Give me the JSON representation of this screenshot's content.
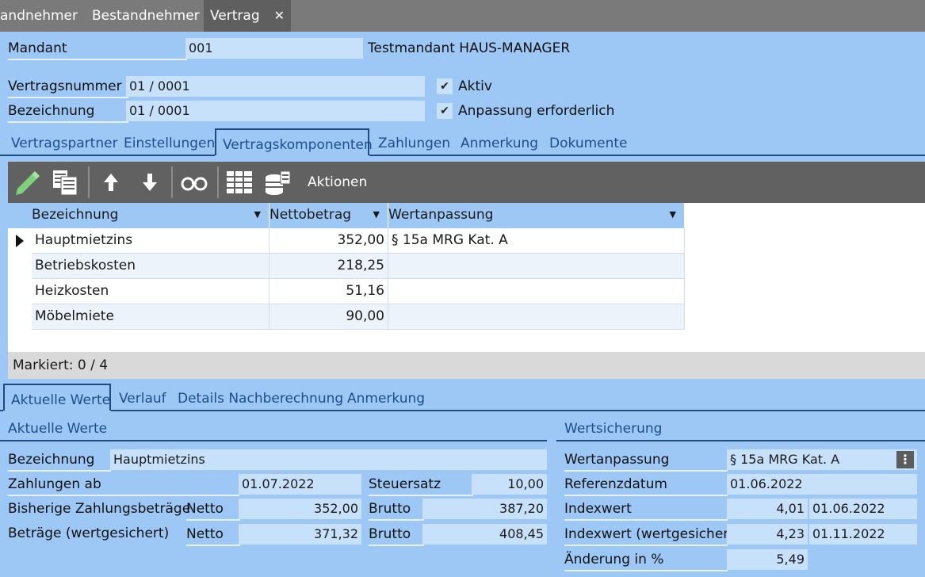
{
  "top_tabs": [
    {
      "label": "andnehmer"
    },
    {
      "label": "Bestandnehmer"
    },
    {
      "label": "Vertrag",
      "close": "✕"
    }
  ],
  "mandant": {
    "label": "Mandant",
    "code": "001",
    "name": "Testmandant HAUS-MANAGER"
  },
  "contract": {
    "number_label": "Vertragsnummer",
    "number": "01 / 0001",
    "desc_label": "Bezeichnung",
    "desc": "01 / 0001",
    "active_label": "Aktiv",
    "active_checked": true,
    "adjust_label": "Anpassung erforderlich",
    "adjust_checked": true
  },
  "main_tabs": [
    "Vertragspartner",
    "Einstellungen",
    "Vertragskomponenten",
    "Zahlungen",
    "Anmerkung",
    "Dokumente"
  ],
  "main_tabs_active": 2,
  "toolbar": {
    "actions_label": "Aktionen"
  },
  "grid": {
    "columns": [
      "Bezeichnung",
      "Nettobetrag",
      "Wertanpassung"
    ],
    "rows": [
      {
        "bezeichnung": "Hauptmietzins",
        "netto": "352,00",
        "wertanpassung": "§ 15a MRG Kat. A"
      },
      {
        "bezeichnung": "Betriebskosten",
        "netto": "218,25",
        "wertanpassung": ""
      },
      {
        "bezeichnung": "Heizkosten",
        "netto": "51,16",
        "wertanpassung": ""
      },
      {
        "bezeichnung": "Möbelmiete",
        "netto": "90,00",
        "wertanpassung": ""
      }
    ],
    "marked": "Markiert: 0 / 4"
  },
  "sub_tabs": [
    "Aktuelle Werte",
    "Verlauf",
    "Details Nachberechnung",
    "Anmerkung"
  ],
  "sub_tabs_active": 0,
  "current_values": {
    "title": "Aktuelle Werte",
    "bez_label": "Bezeichnung",
    "bez": "Hauptmietzins",
    "zahl_ab_label": "Zahlungen ab",
    "zahl_ab": "01.07.2022",
    "steuer_label": "Steuersatz",
    "steuer": "10,00",
    "bisher_label": "Bisherige Zahlungsbeträge",
    "bisher_netto_label": "Netto",
    "bisher_netto": "352,00",
    "bisher_brutto_label": "Brutto",
    "bisher_brutto": "387,20",
    "wert_label": "Beträge (wertgesichert)",
    "wert_netto_label": "Netto",
    "wert_netto": "371,32",
    "wert_brutto_label": "Brutto",
    "wert_brutto": "408,45"
  },
  "wertsicherung": {
    "title": "Wertsicherung",
    "wa_label": "Wertanpassung",
    "wa": "§ 15a MRG Kat. A",
    "menu": "⋮",
    "ref_label": "Referenzdatum",
    "ref": "01.06.2022",
    "idx_label": "Indexwert",
    "idx": "4,01",
    "idx_date": "01.06.2022",
    "idxw_label": "Indexwert (wertgesichert)",
    "idxw": "4,23",
    "idxw_date": "01.11.2022",
    "change_label": "Änderung in %",
    "change": "5,49"
  }
}
